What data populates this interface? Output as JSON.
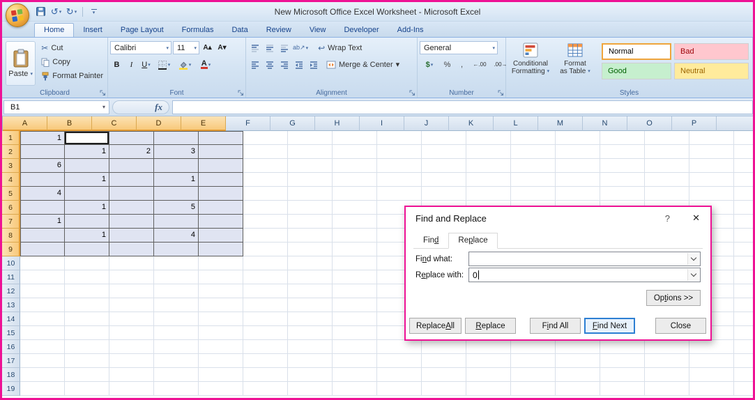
{
  "window": {
    "title": "New Microsoft Office Excel Worksheet - Microsoft Excel",
    "annotation_border_color": "#EE1295"
  },
  "icons": {
    "dropdown": "▾",
    "undo": "↺",
    "redo": "↻",
    "cut": "✂",
    "grow_font": "A▴",
    "shrink_font": "A▾",
    "orientation": "ab↗",
    "wrap_text": "↩",
    "dollar": "$",
    "percent": "%",
    "comma": ",",
    "increase_decimal": "←.00",
    "decrease_decimal": ".00→",
    "fx": "fx"
  },
  "ribbon_tabs": [
    {
      "label": "Home",
      "active": true
    },
    {
      "label": "Insert",
      "active": false
    },
    {
      "label": "Page Layout",
      "active": false
    },
    {
      "label": "Formulas",
      "active": false
    },
    {
      "label": "Data",
      "active": false
    },
    {
      "label": "Review",
      "active": false
    },
    {
      "label": "View",
      "active": false
    },
    {
      "label": "Developer",
      "active": false
    },
    {
      "label": "Add-Ins",
      "active": false
    }
  ],
  "ribbon": {
    "clipboard": {
      "label": "Clipboard",
      "paste": "Paste",
      "cut": "Cut",
      "copy": "Copy",
      "format_painter": "Format Painter"
    },
    "font": {
      "label": "Font",
      "family": "Calibri",
      "size": "11",
      "bold": "B",
      "italic": "I",
      "underline": "U"
    },
    "alignment": {
      "label": "Alignment",
      "wrap_text": "Wrap Text",
      "merge_center": "Merge & Center"
    },
    "number": {
      "label": "Number",
      "format": "General"
    },
    "styles": {
      "label": "Styles",
      "conditional_formatting_1": "Conditional",
      "conditional_formatting_2": "Formatting",
      "format_as_table_1": "Format",
      "format_as_table_2": "as Table",
      "gallery": [
        {
          "name": "Normal",
          "bg": "#FFFFFF",
          "fg": "#000000",
          "selected": true
        },
        {
          "name": "Bad",
          "bg": "#FFC7CE",
          "fg": "#9C0006",
          "selected": false
        },
        {
          "name": "Good",
          "bg": "#C6EFCE",
          "fg": "#006100",
          "selected": false
        },
        {
          "name": "Neutral",
          "bg": "#FFEB9C",
          "fg": "#9C6500",
          "selected": false
        }
      ]
    }
  },
  "formula_bar": {
    "name_box": "B1",
    "formula": ""
  },
  "grid": {
    "columns": [
      "A",
      "B",
      "C",
      "D",
      "E",
      "F",
      "G",
      "H",
      "I",
      "J",
      "K",
      "L",
      "M",
      "N",
      "O",
      "P"
    ],
    "row_count": 19,
    "cells": {
      "A1": "1",
      "B2": "1",
      "C2": "2",
      "D2": "3",
      "A3": "6",
      "B4": "1",
      "D4": "1",
      "A5": "4",
      "B6": "1",
      "D6": "5",
      "A7": "1",
      "B8": "1",
      "D8": "4"
    },
    "selection": {
      "active_cell": "B1",
      "range": "A1:E9",
      "cols": [
        "A",
        "B",
        "C",
        "D",
        "E"
      ],
      "first_row": 1,
      "last_row": 9
    },
    "colors": {
      "selection_fill": "#E0E4F2",
      "range_border": "#5F5F5F",
      "header_highlight": "#F8C97B"
    }
  },
  "dialog": {
    "title": "Find and Replace",
    "help_icon": "?",
    "close_icon": "✕",
    "tabs": [
      {
        "label": "Find",
        "mnemonic": 3,
        "active": false
      },
      {
        "label": "Replace",
        "mnemonic": 2,
        "active": true
      }
    ],
    "fields": [
      {
        "label": "Find what:",
        "mnemonic": 2,
        "value": "",
        "caret": false
      },
      {
        "label": "Replace with:",
        "mnemonic": 1,
        "value": "0",
        "caret": true
      }
    ],
    "options_button": {
      "label": "Options >>",
      "mnemonic": 2
    },
    "buttons": [
      {
        "label": "Replace All",
        "mnemonic": 8,
        "default": false
      },
      {
        "label": "Replace",
        "mnemonic": 0,
        "default": false
      },
      {
        "label": "Find All",
        "mnemonic": 1,
        "default": false
      },
      {
        "label": "Find Next",
        "mnemonic": 0,
        "default": true
      },
      {
        "label": "Close",
        "mnemonic": -1,
        "default": false
      }
    ]
  }
}
